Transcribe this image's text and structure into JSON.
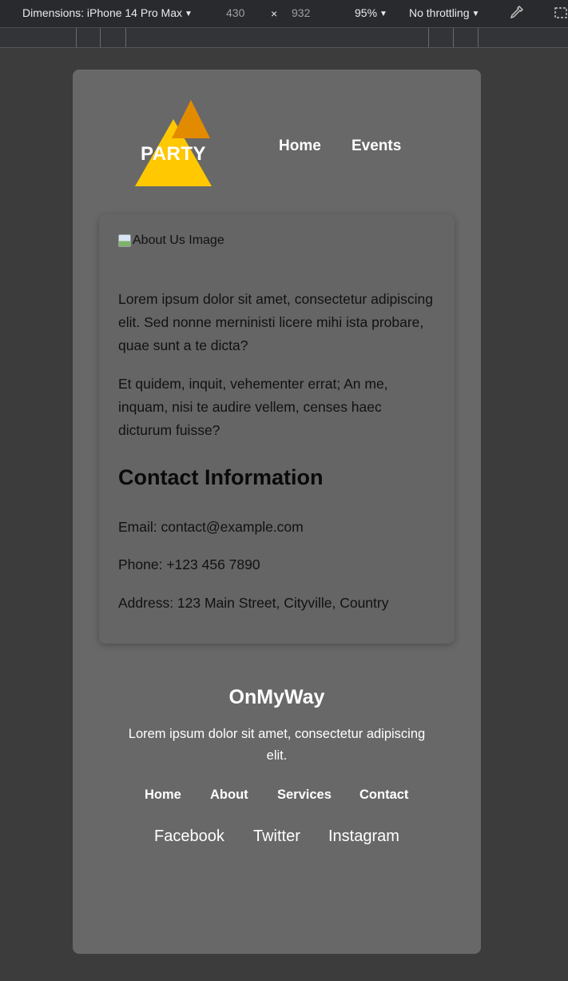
{
  "devtools": {
    "dimensions_label": "Dimensions: iPhone 14 Pro Max",
    "width": "430",
    "times": "×",
    "height": "932",
    "zoom": "95%",
    "throttling": "No throttling",
    "icons": [
      "dropdown-arrow-icon",
      "eyedropper-icon",
      "device-frame-icon"
    ]
  },
  "header": {
    "logo_text": "PARTY",
    "nav": [
      "Home",
      "Events"
    ],
    "colors": {
      "triangle_main": "#ffc800",
      "triangle_back": "#e38b00"
    }
  },
  "about": {
    "image_alt": "About Us Image",
    "paragraphs": [
      "Lorem ipsum dolor sit amet, consectetur adipiscing elit. Sed nonne merninisti licere mihi ista probare, quae sunt a te dicta?",
      "Et quidem, inquit, vehementer errat; An me, inquam, nisi te audire vellem, censes haec dicturum fuisse?"
    ]
  },
  "contact": {
    "heading": "Contact Information",
    "email": "Email: contact@example.com",
    "phone": "Phone: +123 456 7890",
    "address": "Address: 123 Main Street, Cityville, Country"
  },
  "footer": {
    "title": "OnMyWay",
    "text": "Lorem ipsum dolor sit amet, consectetur adipiscing elit.",
    "links": [
      "Home",
      "About",
      "Services",
      "Contact"
    ],
    "social": [
      "Facebook",
      "Twitter",
      "Instagram"
    ]
  }
}
